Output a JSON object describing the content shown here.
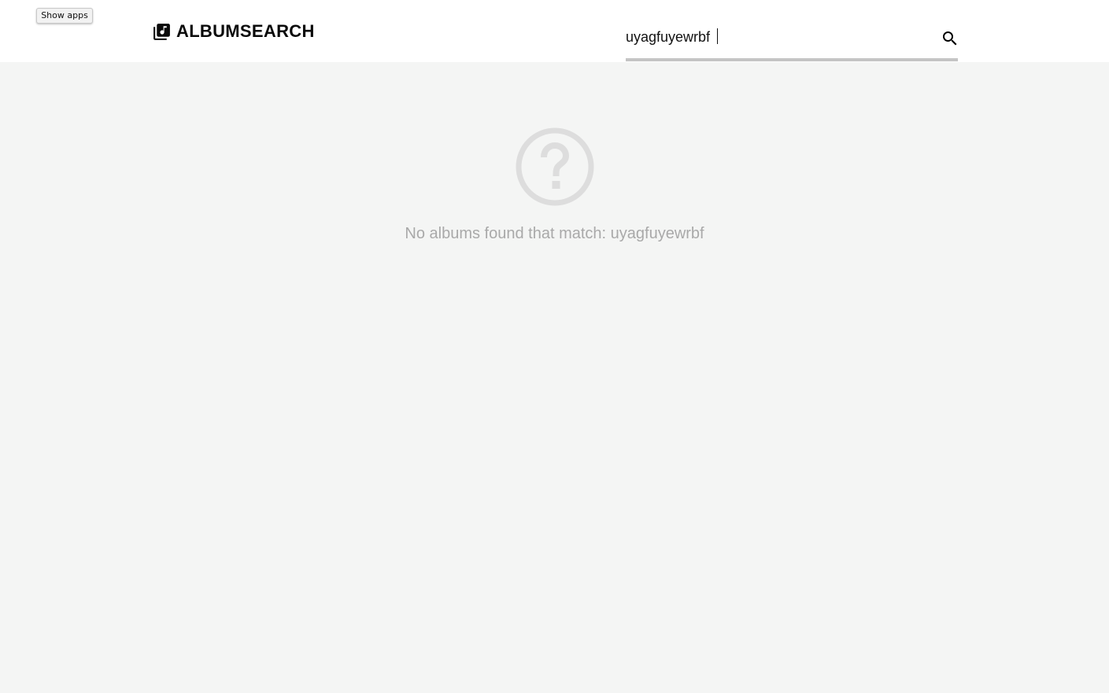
{
  "top_bar": {
    "show_apps_label": "Show apps"
  },
  "header": {
    "logo_icon": "album-library-icon",
    "title": "ALBUMSEARCH"
  },
  "search": {
    "value": "uyagfuyewrbf",
    "button_icon": "search-icon"
  },
  "empty_state": {
    "icon": "question-circle-icon",
    "message": "No albums found that match: uyagfuyewrbf"
  },
  "colors": {
    "page_background": "#f4f5f4",
    "header_background": "#ffffff",
    "muted_text": "#a9a9a9",
    "empty_icon": "#dddddd",
    "search_underline": "#c4c4c4"
  }
}
